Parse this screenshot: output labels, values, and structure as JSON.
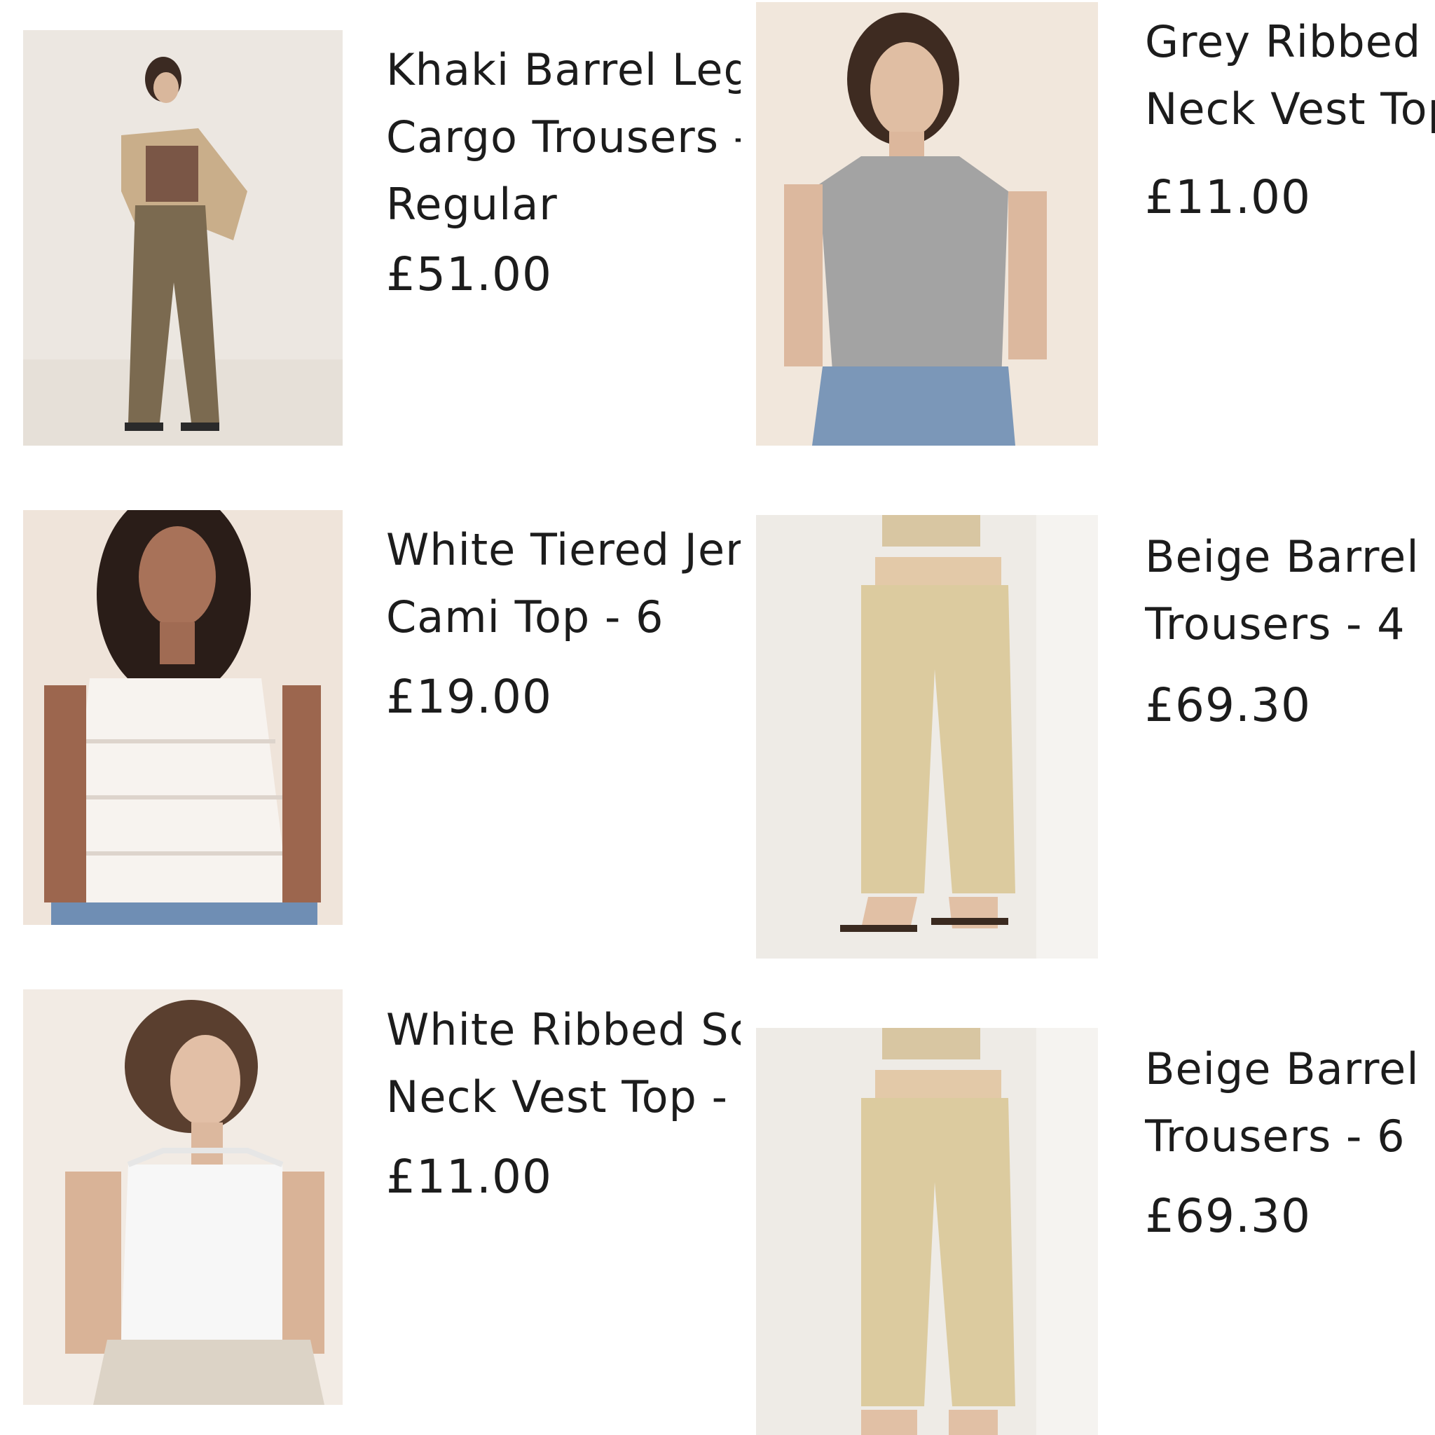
{
  "products": [
    {
      "title_lines": [
        "Khaki Barrel Leg",
        "Cargo Trousers -",
        "Regular"
      ],
      "price": "£51.00",
      "image_desc": "khaki-cargo-trousers-photo"
    },
    {
      "title_lines": [
        "Grey Ribbed Scoop",
        "Neck Vest Top"
      ],
      "price": "£11.00",
      "image_desc": "grey-vest-top-photo"
    },
    {
      "title_lines": [
        "White Tiered Jersey",
        "Cami Top - 6"
      ],
      "price": "£19.00",
      "image_desc": "white-cami-top-photo"
    },
    {
      "title_lines": [
        "Beige Barrel Leg",
        "Trousers - 4"
      ],
      "price": "£69.30",
      "image_desc": "beige-trousers-photo"
    },
    {
      "title_lines": [
        "White Ribbed Scoop",
        "Neck Vest Top -"
      ],
      "price": "£11.00",
      "image_desc": "white-vest-top-photo"
    },
    {
      "title_lines": [
        "Beige Barrel Leg",
        "Trousers - 6"
      ],
      "price": "£69.30",
      "image_desc": "beige-trousers-photo"
    }
  ]
}
